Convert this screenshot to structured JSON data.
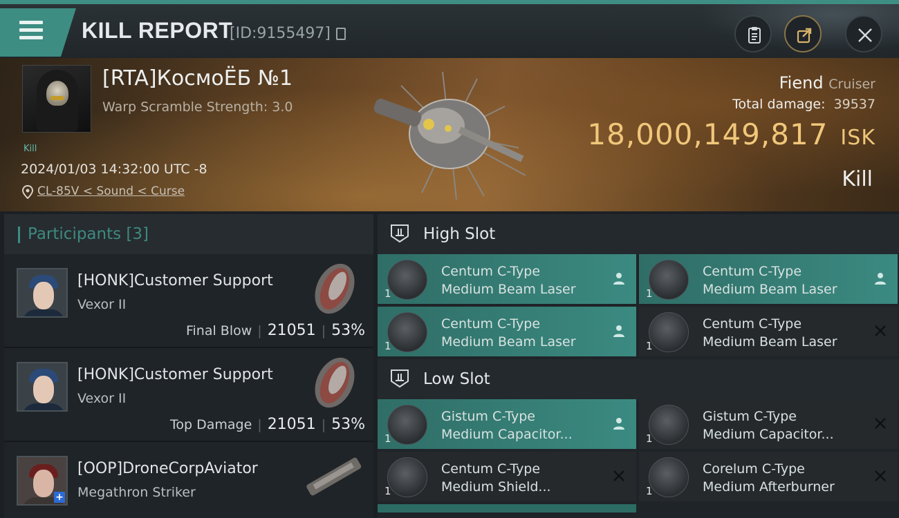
{
  "header": {
    "title": "KILL REPORT",
    "report_id": "[ID:9155497]",
    "buttons": [
      {
        "icon": "clipboard-icon"
      },
      {
        "icon": "share-icon"
      },
      {
        "icon": "close-icon"
      }
    ]
  },
  "victim": {
    "name": "[RTA]КосмоЁБ №1",
    "warp_scramble": "Warp Scramble Strength: 3.0",
    "tag": "Kill",
    "timestamp": "2024/01/03 14:32:00 UTC -8",
    "location": "CL-85V < Sound < Curse",
    "ship_name": "Fiend",
    "ship_class": "Cruiser",
    "total_damage_label": "Total damage:",
    "total_damage": "39537",
    "isk_value": "18,000,149,817",
    "isk_unit": "ISK",
    "outcome": "Kill"
  },
  "participants": {
    "title": "Participants",
    "count": "[3]",
    "items": [
      {
        "name": "[HONK]Customer Support",
        "ship": "Vexor II",
        "role": "Final Blow",
        "damage": "21051",
        "percent": "53%"
      },
      {
        "name": "[HONK]Customer Support",
        "ship": "Vexor II",
        "role": "Top Damage",
        "damage": "21051",
        "percent": "53%"
      },
      {
        "name": "[OOP]DroneCorpAviator",
        "ship": "Megathron Striker",
        "role": "",
        "damage": "",
        "percent": ""
      }
    ]
  },
  "slots": {
    "high": {
      "label": "High Slot",
      "modules": [
        {
          "line1": "Centum C-Type",
          "line2": "Medium Beam Laser",
          "qty": "1",
          "state": "fitted"
        },
        {
          "line1": "Centum C-Type",
          "line2": "Medium Beam Laser",
          "qty": "1",
          "state": "fitted"
        },
        {
          "line1": "Centum C-Type",
          "line2": "Medium Beam Laser",
          "qty": "1",
          "state": "fitted"
        },
        {
          "line1": "Centum C-Type",
          "line2": "Medium Beam Laser",
          "qty": "1",
          "state": "destroyed"
        }
      ]
    },
    "low": {
      "label": "Low Slot",
      "modules": [
        {
          "line1": "Gistum C-Type",
          "line2": "Medium Capacitor...",
          "qty": "1",
          "state": "fitted"
        },
        {
          "line1": "Gistum C-Type",
          "line2": "Medium Capacitor...",
          "qty": "1",
          "state": "destroyed"
        },
        {
          "line1": "Centum C-Type",
          "line2": "Medium Shield...",
          "qty": "1",
          "state": "destroyed"
        },
        {
          "line1": "Corelum C-Type",
          "line2": "Medium Afterburner",
          "qty": "1",
          "state": "destroyed"
        }
      ]
    }
  },
  "colors": {
    "accent": "#3d8d83",
    "isk_gold": "#f0c77b",
    "fitted_bg": "#3b8a81",
    "panel_bg": "#1f2428"
  }
}
